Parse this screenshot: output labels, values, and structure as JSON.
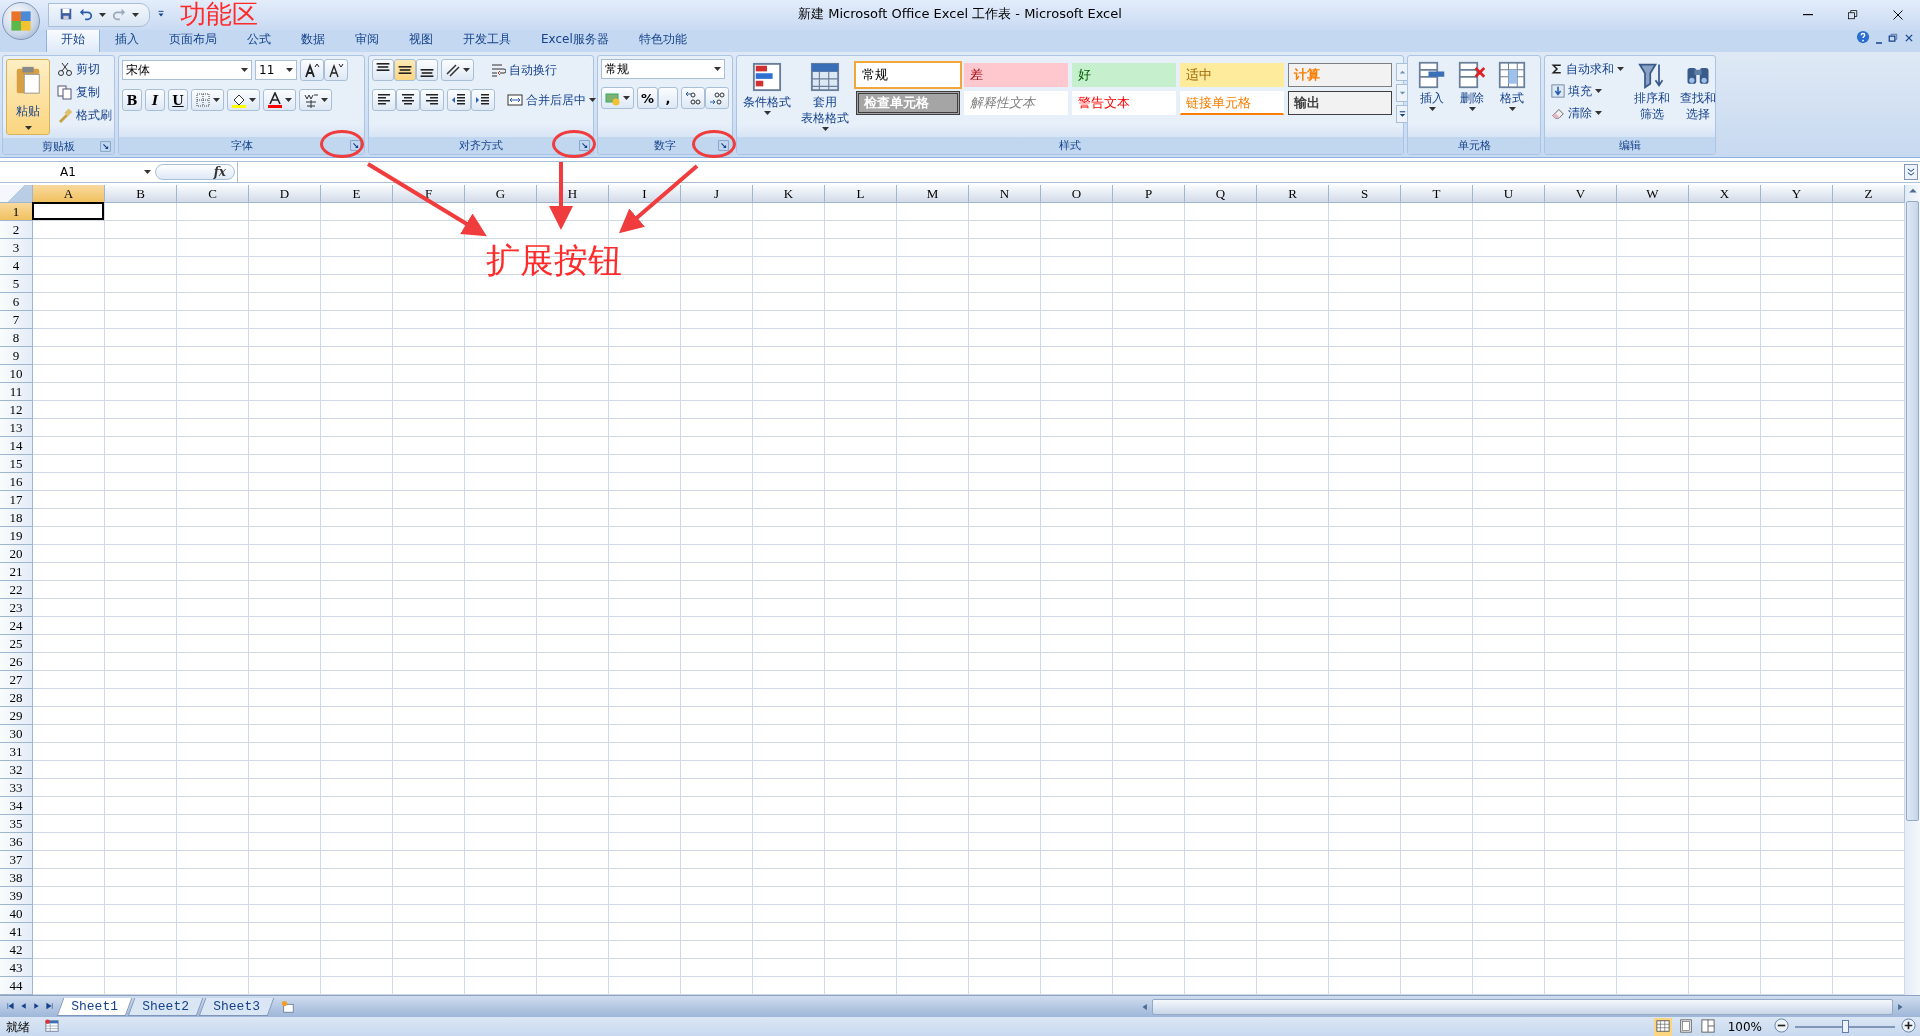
{
  "title_bar": {
    "title": "新建 Microsoft Office Excel 工作表 - Microsoft Excel"
  },
  "annotations": {
    "ribbon_label": "功能区",
    "expander_label": "扩展按钮"
  },
  "tabs": [
    {
      "label": "开始",
      "selected": true
    },
    {
      "label": "插入",
      "selected": false
    },
    {
      "label": "页面布局",
      "selected": false
    },
    {
      "label": "公式",
      "selected": false
    },
    {
      "label": "数据",
      "selected": false
    },
    {
      "label": "审阅",
      "selected": false
    },
    {
      "label": "视图",
      "selected": false
    },
    {
      "label": "开发工具",
      "selected": false
    },
    {
      "label": "Excel服务器",
      "selected": false
    },
    {
      "label": "特色功能",
      "selected": false
    }
  ],
  "clipboard": {
    "label": "剪贴板",
    "paste": "粘贴",
    "items": [
      "剪切",
      "复制",
      "格式刷"
    ]
  },
  "font": {
    "label": "字体",
    "font_name": "宋体",
    "font_size": "11",
    "format_buttons": [
      "B",
      "I",
      "U"
    ]
  },
  "alignment": {
    "label": "对齐方式",
    "wrap_text": "自动换行",
    "merge_center": "合并后居中"
  },
  "number": {
    "label": "数字",
    "format": "常规",
    "symbols": [
      "%",
      ","
    ]
  },
  "styles": {
    "label": "样式",
    "conditional_format": "条件格式",
    "table_format": [
      "套用",
      "表格格式"
    ],
    "cell_styles": [
      {
        "label": "常规",
        "kind": "normal",
        "selected": true
      },
      {
        "label": "差",
        "kind": "bad",
        "selected": false
      },
      {
        "label": "好",
        "kind": "good",
        "selected": false
      },
      {
        "label": "适中",
        "kind": "neutral",
        "selected": false
      },
      {
        "label": "计算",
        "kind": "calculation",
        "selected": false
      },
      {
        "label": "检查单元格",
        "kind": "check",
        "selected": false
      },
      {
        "label": "解释性文本",
        "kind": "explanatory",
        "selected": false
      },
      {
        "label": "警告文本",
        "kind": "warning",
        "selected": false
      },
      {
        "label": "链接单元格",
        "kind": "linked",
        "selected": false
      },
      {
        "label": "输出",
        "kind": "output",
        "selected": false
      }
    ]
  },
  "cells": {
    "label": "单元格",
    "buttons": [
      "插入",
      "删除",
      "格式"
    ]
  },
  "editing": {
    "label": "编辑",
    "autosum": "自动求和",
    "fill": "填充",
    "clear": "清除",
    "sort_filter": [
      "排序和",
      "筛选"
    ],
    "find_select": [
      "查找和",
      "选择"
    ]
  },
  "formula_bar": {
    "name_box": "A1",
    "fx_label": "fx"
  },
  "columns": [
    {
      "label": "A",
      "selected": true
    },
    {
      "label": "B",
      "selected": false
    },
    {
      "label": "C",
      "selected": false
    },
    {
      "label": "D",
      "selected": false
    },
    {
      "label": "E",
      "selected": false
    },
    {
      "label": "F",
      "selected": false
    },
    {
      "label": "G",
      "selected": false
    },
    {
      "label": "H",
      "selected": false
    },
    {
      "label": "I",
      "selected": false
    },
    {
      "label": "J",
      "selected": false
    },
    {
      "label": "K",
      "selected": false
    },
    {
      "label": "L",
      "selected": false
    },
    {
      "label": "M",
      "selected": false
    },
    {
      "label": "N",
      "selected": false
    },
    {
      "label": "O",
      "selected": false
    },
    {
      "label": "P",
      "selected": false
    },
    {
      "label": "Q",
      "selected": false
    },
    {
      "label": "R",
      "selected": false
    },
    {
      "label": "S",
      "selected": false
    },
    {
      "label": "T",
      "selected": false
    },
    {
      "label": "U",
      "selected": false
    },
    {
      "label": "V",
      "selected": false
    },
    {
      "label": "W",
      "selected": false
    },
    {
      "label": "X",
      "selected": false
    },
    {
      "label": "Y",
      "selected": false
    },
    {
      "label": "Z",
      "selected": false
    }
  ],
  "rows": [
    {
      "label": "1",
      "selected": true
    },
    {
      "label": "2",
      "selected": false
    },
    {
      "label": "3",
      "selected": false
    },
    {
      "label": "4",
      "selected": false
    },
    {
      "label": "5",
      "selected": false
    },
    {
      "label": "6",
      "selected": false
    },
    {
      "label": "7",
      "selected": false
    },
    {
      "label": "8",
      "selected": false
    },
    {
      "label": "9",
      "selected": false
    },
    {
      "label": "10",
      "selected": false
    },
    {
      "label": "11",
      "selected": false
    },
    {
      "label": "12",
      "selected": false
    },
    {
      "label": "13",
      "selected": false
    },
    {
      "label": "14",
      "selected": false
    },
    {
      "label": "15",
      "selected": false
    },
    {
      "label": "16",
      "selected": false
    },
    {
      "label": "17",
      "selected": false
    },
    {
      "label": "18",
      "selected": false
    },
    {
      "label": "19",
      "selected": false
    },
    {
      "label": "20",
      "selected": false
    },
    {
      "label": "21",
      "selected": false
    },
    {
      "label": "22",
      "selected": false
    },
    {
      "label": "23",
      "selected": false
    },
    {
      "label": "24",
      "selected": false
    },
    {
      "label": "25",
      "selected": false
    },
    {
      "label": "26",
      "selected": false
    },
    {
      "label": "27",
      "selected": false
    },
    {
      "label": "28",
      "selected": false
    },
    {
      "label": "29",
      "selected": false
    },
    {
      "label": "30",
      "selected": false
    },
    {
      "label": "31",
      "selected": false
    },
    {
      "label": "32",
      "selected": false
    },
    {
      "label": "33",
      "selected": false
    },
    {
      "label": "34",
      "selected": false
    },
    {
      "label": "35",
      "selected": false
    },
    {
      "label": "36",
      "selected": false
    },
    {
      "label": "37",
      "selected": false
    },
    {
      "label": "38",
      "selected": false
    },
    {
      "label": "39",
      "selected": false
    },
    {
      "label": "40",
      "selected": false
    },
    {
      "label": "41",
      "selected": false
    },
    {
      "label": "42",
      "selected": false
    },
    {
      "label": "43",
      "selected": false
    },
    {
      "label": "44",
      "selected": false
    }
  ],
  "sheet_tabs": [
    {
      "label": "Sheet1",
      "selected": true
    },
    {
      "label": "Sheet2",
      "selected": false
    },
    {
      "label": "Sheet3",
      "selected": false
    }
  ],
  "status_bar": {
    "status": "就绪",
    "zoom": "100%",
    "zoom_slider": {
      "level": 0.5
    }
  }
}
